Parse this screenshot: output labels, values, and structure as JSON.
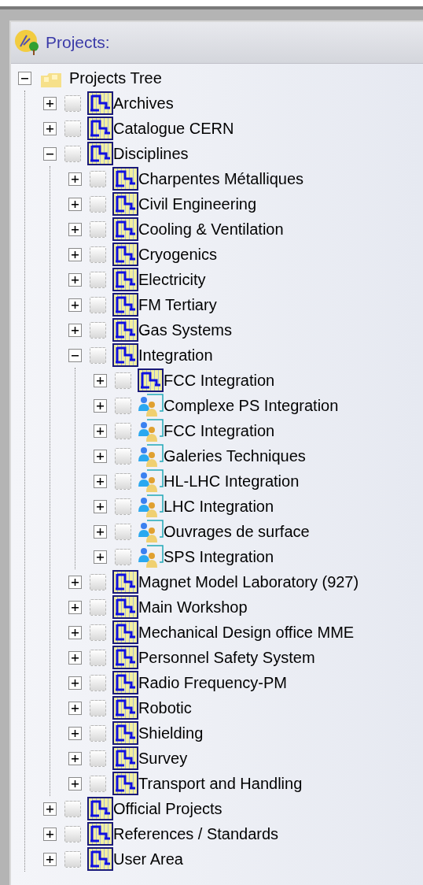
{
  "panel": {
    "title": "Projects:"
  },
  "tree": {
    "label": "Projects Tree",
    "kind": "root",
    "expanded": true,
    "children": [
      {
        "label": "Archives",
        "kind": "project",
        "checked": false,
        "expanded": false
      },
      {
        "label": "Catalogue CERN",
        "kind": "project",
        "checked": false,
        "expanded": false
      },
      {
        "label": "Disciplines",
        "kind": "project",
        "checked": false,
        "expanded": true,
        "children": [
          {
            "label": "Charpentes Métalliques",
            "kind": "project",
            "checked": false,
            "expanded": false
          },
          {
            "label": "Civil Engineering",
            "kind": "project",
            "checked": false,
            "expanded": false
          },
          {
            "label": "Cooling & Ventilation",
            "kind": "project",
            "checked": false,
            "expanded": false
          },
          {
            "label": "Cryogenics",
            "kind": "project",
            "checked": false,
            "expanded": false
          },
          {
            "label": "Electricity",
            "kind": "project",
            "checked": false,
            "expanded": false
          },
          {
            "label": "FM Tertiary",
            "kind": "project",
            "checked": false,
            "expanded": false
          },
          {
            "label": "Gas Systems",
            "kind": "project",
            "checked": false,
            "expanded": false
          },
          {
            "label": "Integration",
            "kind": "project",
            "checked": false,
            "expanded": true,
            "children": [
              {
                "label": "FCC Integration",
                "kind": "project",
                "checked": false,
                "expanded": false
              },
              {
                "label": "Complexe PS Integration",
                "kind": "group",
                "checked": false,
                "expanded": false
              },
              {
                "label": "FCC Integration",
                "kind": "group",
                "checked": false,
                "expanded": false
              },
              {
                "label": "Galeries Techniques",
                "kind": "group",
                "checked": false,
                "expanded": false
              },
              {
                "label": "HL-LHC Integration",
                "kind": "group",
                "checked": false,
                "expanded": false
              },
              {
                "label": "LHC Integration",
                "kind": "group",
                "checked": false,
                "expanded": false
              },
              {
                "label": "Ouvrages de surface",
                "kind": "group",
                "checked": false,
                "expanded": false
              },
              {
                "label": "SPS Integration",
                "kind": "group",
                "checked": false,
                "expanded": false
              }
            ]
          },
          {
            "label": "Magnet Model Laboratory (927)",
            "kind": "project",
            "checked": false,
            "expanded": false
          },
          {
            "label": "Main Workshop",
            "kind": "project",
            "checked": false,
            "expanded": false
          },
          {
            "label": "Mechanical Design office MME",
            "kind": "project",
            "checked": false,
            "expanded": false
          },
          {
            "label": "Personnel Safety System",
            "kind": "project",
            "checked": false,
            "expanded": false
          },
          {
            "label": "Radio Frequency-PM",
            "kind": "project",
            "checked": false,
            "expanded": false
          },
          {
            "label": "Robotic",
            "kind": "project",
            "checked": false,
            "expanded": false
          },
          {
            "label": "Shielding",
            "kind": "project",
            "checked": false,
            "expanded": false
          },
          {
            "label": "Survey",
            "kind": "project",
            "checked": false,
            "expanded": false
          },
          {
            "label": "Transport and Handling",
            "kind": "project",
            "checked": false,
            "expanded": false
          }
        ]
      },
      {
        "label": "Official Projects",
        "kind": "project",
        "checked": false,
        "expanded": false
      },
      {
        "label": "References / Standards",
        "kind": "project",
        "checked": false,
        "expanded": false
      },
      {
        "label": "User Area",
        "kind": "project",
        "checked": false,
        "expanded": false
      }
    ]
  }
}
